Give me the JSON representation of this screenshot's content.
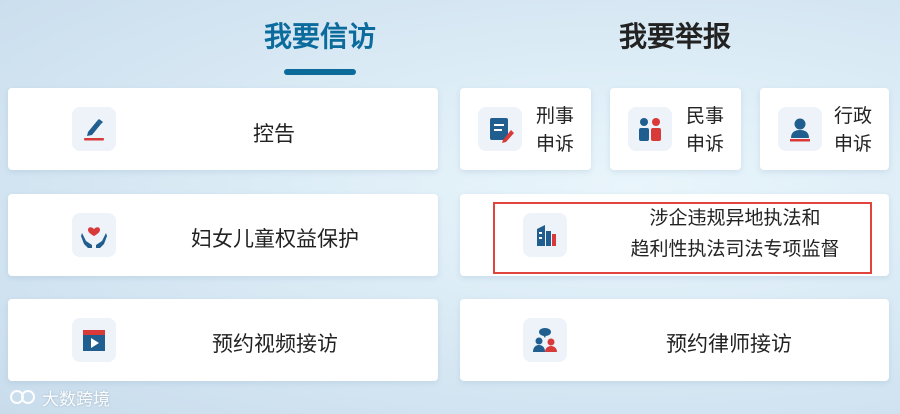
{
  "tabs": {
    "left": "我要信访",
    "right": "我要举报"
  },
  "left_cards": [
    {
      "label": "控告",
      "icon": "pencil-edit-icon"
    },
    {
      "label": "妇女儿童权益保护",
      "icon": "heart-hands-icon"
    },
    {
      "label": "预约视频接访",
      "icon": "video-icon"
    }
  ],
  "right_small_cards": [
    {
      "line1": "刑事",
      "line2": "申诉",
      "icon": "document-edit-icon"
    },
    {
      "line1": "民事",
      "line2": "申诉",
      "icon": "two-people-icon"
    },
    {
      "line1": "行政",
      "line2": "申诉",
      "icon": "person-bust-icon"
    }
  ],
  "right_wide_card": {
    "line1": "涉企违规异地执法和",
    "line2": "趋利性执法司法专项监督",
    "icon": "building-chart-icon"
  },
  "right_lawyer_card": {
    "label": "预约律师接访",
    "icon": "lawyer-chat-icon"
  },
  "watermark": {
    "text": "大数跨境"
  },
  "colors": {
    "accent_blue": "#0c6a9a",
    "icon_blue": "#1f5e8f",
    "icon_red": "#d83a3a",
    "highlight_red": "#e0443c"
  }
}
